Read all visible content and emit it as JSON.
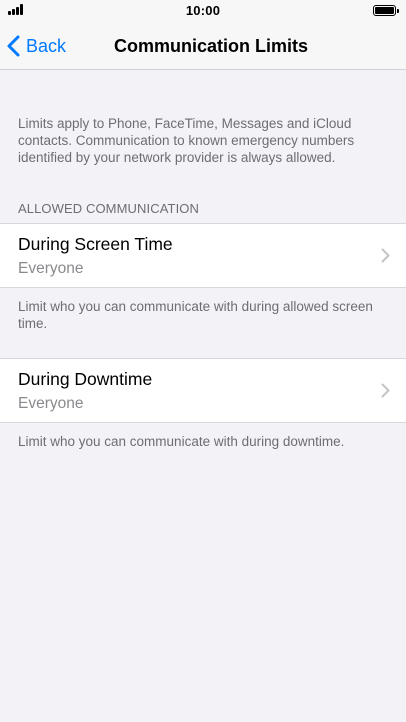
{
  "status_bar": {
    "time": "10:00"
  },
  "nav": {
    "back_label": "Back",
    "title": "Communication Limits"
  },
  "intro": "Limits apply to Phone, FaceTime, Messages and iCloud contacts. Communication to known emergency numbers identified by your network provider is always allowed.",
  "section_header": "ALLOWED COMMUNICATION",
  "rows": [
    {
      "title": "During Screen Time",
      "value": "Everyone",
      "footer": "Limit who you can communicate with during allowed screen time."
    },
    {
      "title": "During Downtime",
      "value": "Everyone",
      "footer": "Limit who you can communicate with during downtime."
    }
  ],
  "colors": {
    "accent": "#007aff",
    "background": "#f2f2f7",
    "secondary_text": "#6d6d72"
  }
}
